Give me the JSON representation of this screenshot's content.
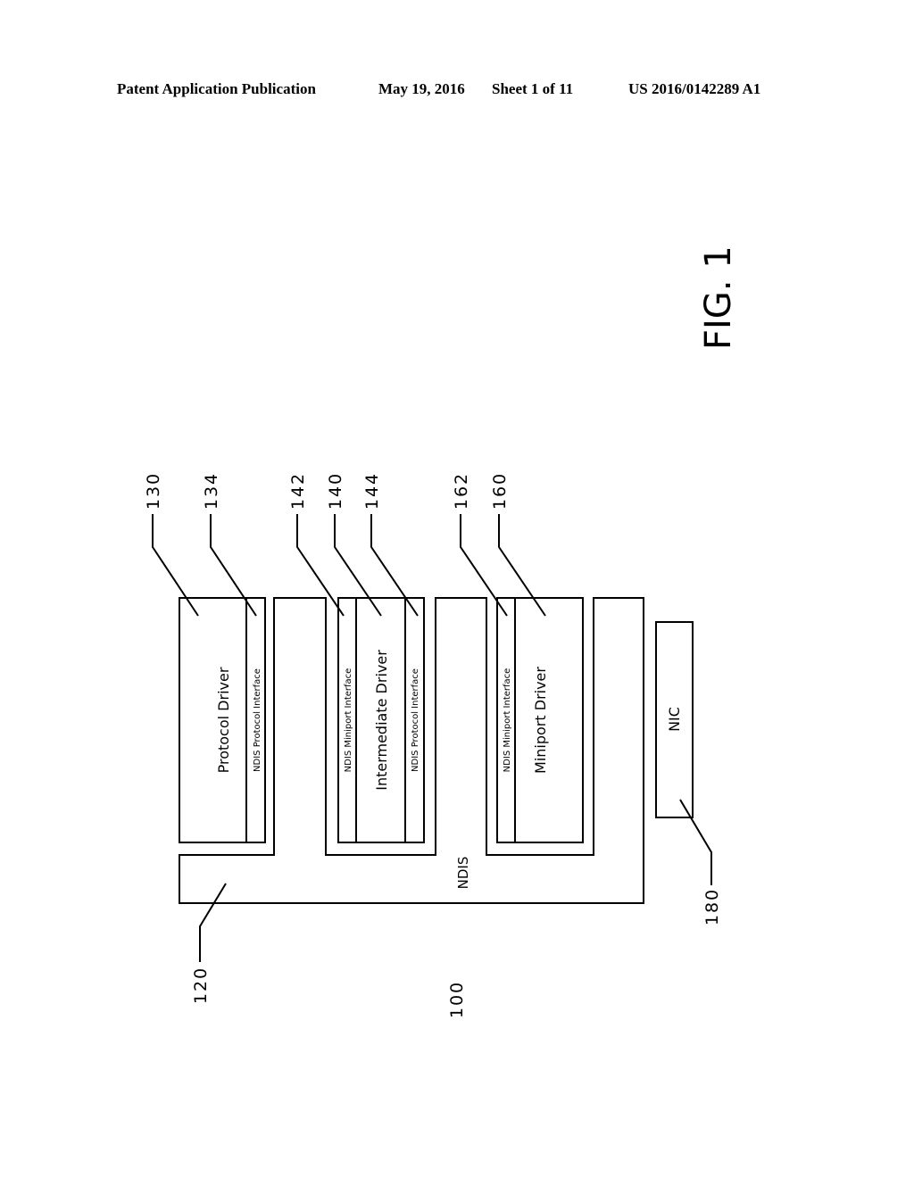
{
  "header": {
    "publication": "Patent Application Publication",
    "date": "May 19, 2016",
    "sheet": "Sheet 1 of 11",
    "number": "US 2016/0142289 A1"
  },
  "figure": {
    "title": "FIG. 1",
    "system_ref": "100",
    "ndis": {
      "label": "NDIS",
      "ref": "120"
    },
    "protocol_driver": {
      "label": "Protocol Driver",
      "ref": "130",
      "protocol_interface": {
        "label": "NDIS Protocol Interface",
        "ref": "134"
      }
    },
    "intermediate_driver": {
      "label": "Intermediate Driver",
      "ref": "140",
      "miniport_interface": {
        "label": "NDIS Miniport Interface",
        "ref": "142"
      },
      "protocol_interface": {
        "label": "NDIS Protocol Interface",
        "ref": "144"
      }
    },
    "miniport_driver": {
      "label": "Miniport Driver",
      "ref": "160",
      "miniport_interface": {
        "label": "NDIS Miniport Interface",
        "ref": "162"
      }
    },
    "nic": {
      "label": "NIC",
      "ref": "180"
    }
  }
}
